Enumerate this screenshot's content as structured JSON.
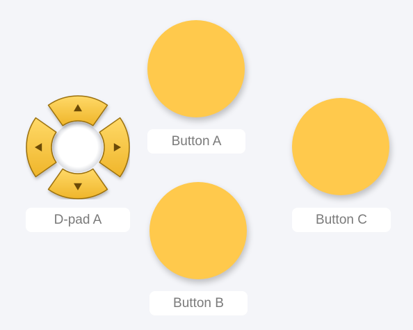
{
  "controls": {
    "dpad": {
      "label": "D-pad A",
      "directions": {
        "up": "up-arrow-icon",
        "down": "down-arrow-icon",
        "left": "left-arrow-icon",
        "right": "right-arrow-icon"
      }
    },
    "button_a": {
      "label": "Button A"
    },
    "button_b": {
      "label": "Button B"
    },
    "button_c": {
      "label": "Button C"
    }
  },
  "colors": {
    "background": "#f4f5f9",
    "button_fill": "#ffc94c",
    "dpad_fill": "#f6c342",
    "dpad_stroke": "#9a6f0c",
    "arrow": "#6b4a06",
    "label_text": "#7a7a7a",
    "label_bg": "#ffffff"
  }
}
